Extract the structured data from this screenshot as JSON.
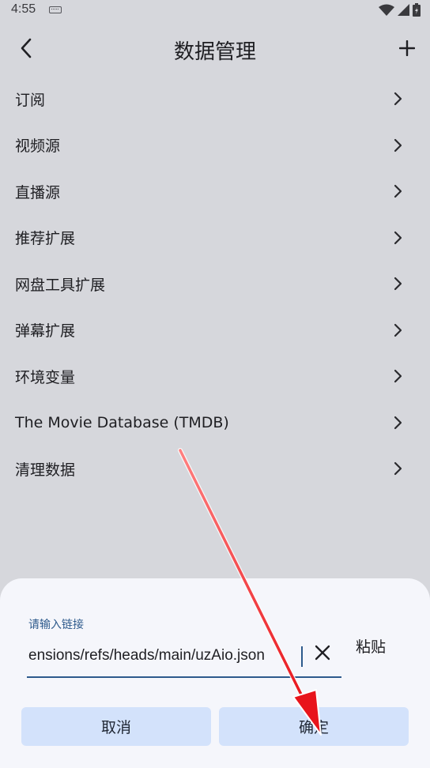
{
  "status_bar": {
    "time": "4:55",
    "icons": [
      "keyboard-icon",
      "wifi-icon",
      "signal-icon",
      "battery-icon"
    ]
  },
  "header": {
    "title": "数据管理",
    "back_icon": "chevron-left-icon",
    "add_icon": "plus-icon"
  },
  "menu": {
    "items": [
      {
        "label": "订阅"
      },
      {
        "label": "视频源"
      },
      {
        "label": "直播源"
      },
      {
        "label": "推荐扩展"
      },
      {
        "label": "网盘工具扩展"
      },
      {
        "label": "弹幕扩展"
      },
      {
        "label": "环境变量"
      },
      {
        "label": "The Movie Database (TMDB)"
      },
      {
        "label": "清理数据"
      }
    ]
  },
  "dialog": {
    "field_label": "请输入链接",
    "input_value": "ensions/refs/heads/main/uzAio.json",
    "paste_label": "粘贴",
    "cancel_label": "取消",
    "confirm_label": "确定"
  },
  "colors": {
    "background": "#d6d7dc",
    "sheet": "#f5f6fb",
    "accent": "#2d5a8c",
    "button_fill": "#d3e2fb",
    "annotation_arrow": "#e8141b"
  }
}
